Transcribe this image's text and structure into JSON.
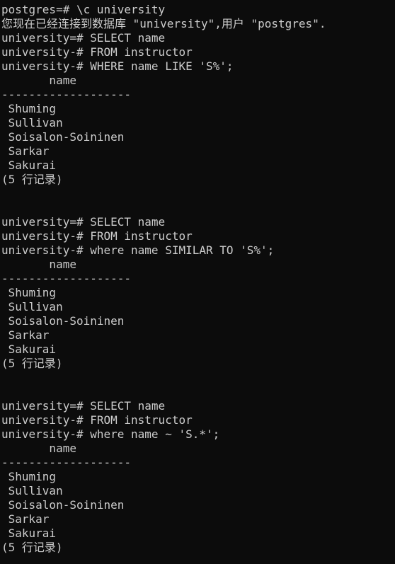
{
  "terminal": {
    "lines": [
      "postgres=# \\c university",
      "您现在已经连接到数据库 \"university\",用户 \"postgres\".",
      "university=# SELECT name",
      "university-# FROM instructor",
      "university-# WHERE name LIKE 'S%';",
      "       name",
      "-------------------",
      " Shuming",
      " Sullivan",
      " Soisalon-Soininen",
      " Sarkar",
      " Sakurai",
      "(5 行记录)",
      "",
      "",
      "university=# SELECT name",
      "university-# FROM instructor",
      "university-# where name SIMILAR TO 'S%';",
      "       name",
      "-------------------",
      " Shuming",
      " Sullivan",
      " Soisalon-Soininen",
      " Sarkar",
      " Sakurai",
      "(5 行记录)",
      "",
      "",
      "university=# SELECT name",
      "university-# FROM instructor",
      "university-# where name ~ 'S.*';",
      "       name",
      "-------------------",
      " Shuming",
      " Sullivan",
      " Soisalon-Soininen",
      " Sarkar",
      " Sakurai",
      "(5 行记录)"
    ]
  }
}
